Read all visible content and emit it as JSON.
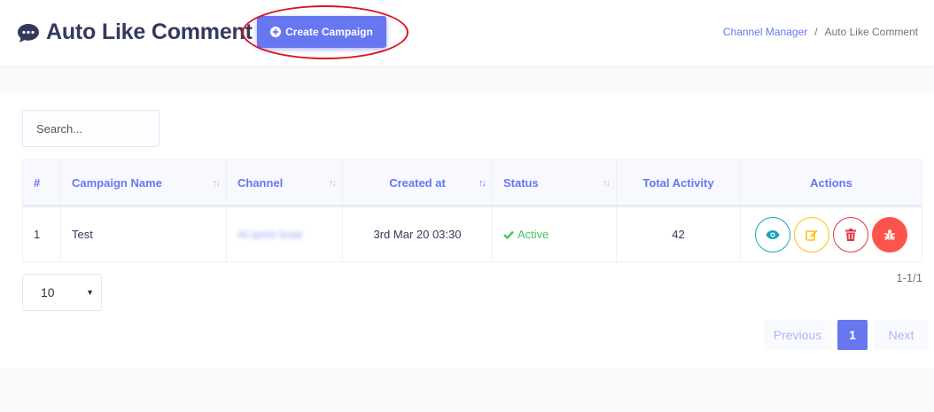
{
  "header": {
    "title": "Auto Like Comment",
    "create_button": "Create Campaign",
    "breadcrumb": {
      "link": "Channel Manager",
      "separator": "/",
      "current": "Auto Like Comment"
    }
  },
  "search": {
    "placeholder": "Search..."
  },
  "table": {
    "columns": [
      "#",
      "Campaign Name",
      "Channel",
      "Created at",
      "Status",
      "Total Activity",
      "Actions"
    ],
    "rows": [
      {
        "index": "1",
        "campaign_name": "Test",
        "channel": "Al-amin boat",
        "created_at": "3rd Mar 20 03:30",
        "status": "Active",
        "total_activity": "42"
      }
    ]
  },
  "pagination": {
    "page_size": "10",
    "range": "1-1/1",
    "previous": "Previous",
    "current_page": "1",
    "next": "Next"
  },
  "colors": {
    "primary": "#6777ef",
    "success": "#47c363",
    "info": "#17a2b8",
    "warning": "#ffc107",
    "danger": "#dc3545",
    "bug": "#fc544b",
    "highlight": "#d7161c"
  }
}
